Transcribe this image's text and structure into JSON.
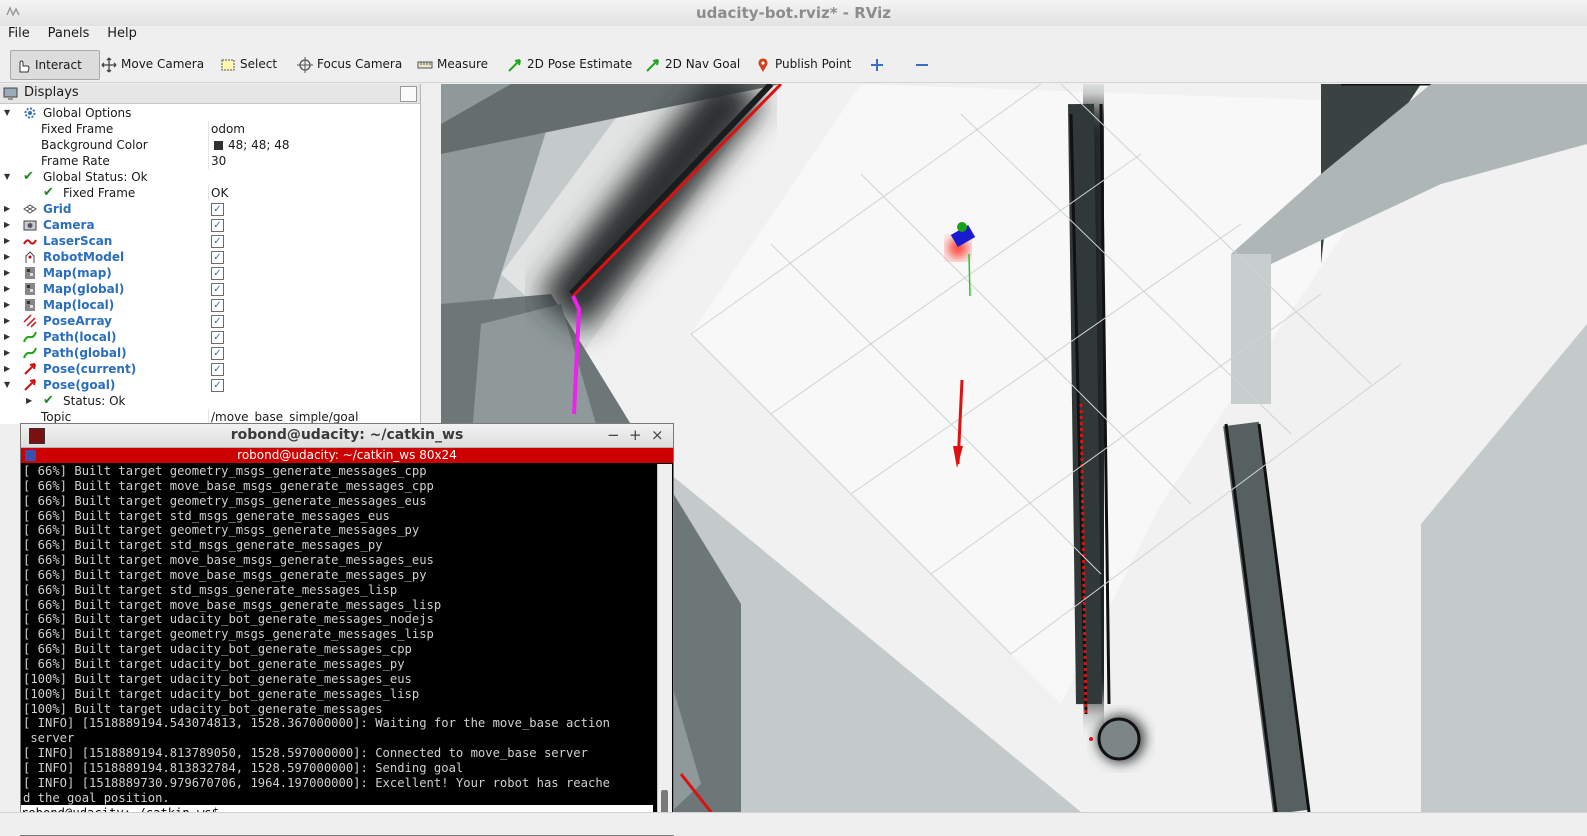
{
  "window": {
    "title": "udacity-bot.rviz* - RViz"
  },
  "menu": [
    "File",
    "Panels",
    "Help"
  ],
  "toolbar": {
    "interact": "Interact",
    "move_camera": "Move Camera",
    "select": "Select",
    "focus_camera": "Focus Camera",
    "measure": "Measure",
    "pose_estimate": "2D Pose Estimate",
    "nav_goal": "2D Nav Goal",
    "publish_point": "Publish Point"
  },
  "displays": {
    "title": "Displays",
    "global_options": "Global Options",
    "fixed_frame_label": "Fixed Frame",
    "fixed_frame_value": "odom",
    "background_color_label": "Background Color",
    "background_color_value": "48; 48; 48",
    "frame_rate_label": "Frame Rate",
    "frame_rate_value": "30",
    "global_status": "Global Status: Ok",
    "status_fixed_frame": "Fixed Frame",
    "status_fixed_frame_value": "OK",
    "items": [
      "Grid",
      "Camera",
      "LaserScan",
      "RobotModel",
      "Map(map)",
      "Map(global)",
      "Map(local)",
      "PoseArray",
      "Path(local)",
      "Path(global)",
      "Pose(current)",
      "Pose(goal)"
    ],
    "goal_status": "Status: Ok",
    "topic_label": "Topic",
    "topic_value": "/move_base_simple/goal"
  },
  "terminal": {
    "title": "robond@udacity: ~/catkin_ws",
    "tab": "robond@udacity: ~/catkin_ws 80x24",
    "lines": [
      "[ 66%] Built target geometry_msgs_generate_messages_cpp",
      "[ 66%] Built target move_base_msgs_generate_messages_cpp",
      "[ 66%] Built target geometry_msgs_generate_messages_eus",
      "[ 66%] Built target std_msgs_generate_messages_eus",
      "[ 66%] Built target geometry_msgs_generate_messages_py",
      "[ 66%] Built target std_msgs_generate_messages_py",
      "[ 66%] Built target move_base_msgs_generate_messages_eus",
      "[ 66%] Built target move_base_msgs_generate_messages_py",
      "[ 66%] Built target std_msgs_generate_messages_lisp",
      "[ 66%] Built target move_base_msgs_generate_messages_lisp",
      "[ 66%] Built target udacity_bot_generate_messages_nodejs",
      "[ 66%] Built target geometry_msgs_generate_messages_lisp",
      "[ 66%] Built target udacity_bot_generate_messages_cpp",
      "[ 66%] Built target udacity_bot_generate_messages_py",
      "[100%] Built target udacity_bot_generate_messages_eus",
      "[100%] Built target udacity_bot_generate_messages_lisp",
      "[100%] Built target udacity_bot_generate_messages",
      "[ INFO] [1518889194.543074813, 1528.367000000]: Waiting for the move_base action",
      " server",
      "[ INFO] [1518889194.813789050, 1528.597000000]: Connected to move_base server",
      "[ INFO] [1518889194.813832784, 1528.597000000]: Sending goal",
      "[ INFO] [1518889730.979670706, 1964.197000000]: Excellent! Your robot has reache",
      "d the goal position."
    ],
    "prompt": "robond@udacity:~/catkin_ws$ "
  }
}
